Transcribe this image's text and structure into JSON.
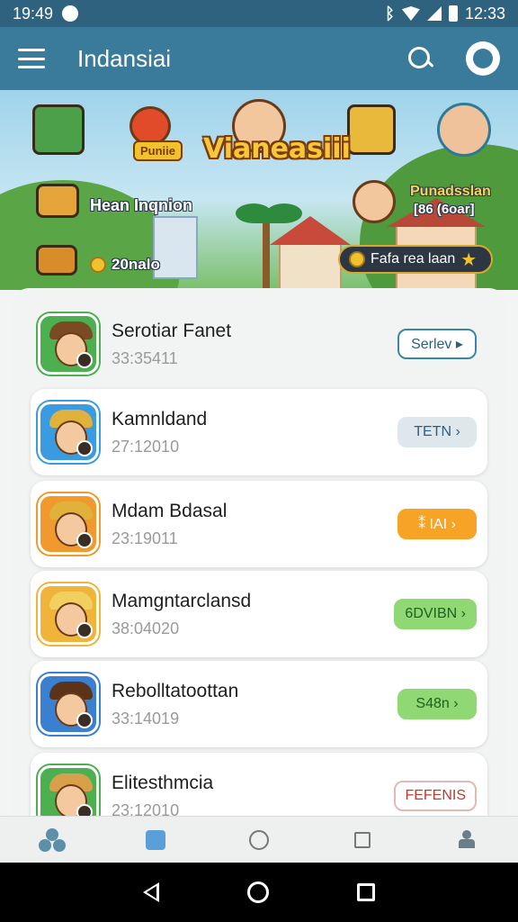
{
  "status_bar": {
    "time_left": "19:49",
    "time_right": "12:33"
  },
  "app_bar": {
    "title": "Indansiai"
  },
  "banner": {
    "title": "Vianeasiii",
    "label_left": "Hean Inqnion",
    "label_right_1": "Punadsslan",
    "label_right_2": "[86 (6oar]",
    "coin_text": "20nalo",
    "pill_text": "Fafa rea laan",
    "badge_text": "Puniie"
  },
  "list": [
    {
      "title": "Serotiar Fanet",
      "subtitle": "33:35411",
      "button": "Serlev ▸",
      "btn_bg": "#ffffff",
      "btn_fg": "#2f5f7e",
      "btn_border": "#3a86a8",
      "icon_bg": "#4caf50",
      "hat": "#7a4a22"
    },
    {
      "title": "Kamnldand",
      "subtitle": "27:12010",
      "button": "TETN ›",
      "btn_bg": "#dde7ec",
      "btn_fg": "#2f5f7e",
      "btn_border": "#dde7ec",
      "icon_bg": "#3b9be0",
      "hat": "#e0b23b"
    },
    {
      "title": "Mdam Bdasal",
      "subtitle": "23:19011",
      "button": "⁑ IAI ›",
      "btn_bg": "#f7a325",
      "btn_fg": "#ffffff",
      "btn_border": "#f7a325",
      "icon_bg": "#f09a2e",
      "hat": "#e0b23b"
    },
    {
      "title": "Mamgntarclansd",
      "subtitle": "38:04020",
      "button": "6DVIBN ›",
      "btn_bg": "#8fd873",
      "btn_fg": "#1f5f1f",
      "btn_border": "#8fd873",
      "icon_bg": "#f0b43a",
      "hat": "#f2d060"
    },
    {
      "title": "Rebolltatoottan",
      "subtitle": "33:14019",
      "button": "S48n ›",
      "btn_bg": "#8fd873",
      "btn_fg": "#1f5f1f",
      "btn_border": "#8fd873",
      "icon_bg": "#3b7fd0",
      "hat": "#5a3318"
    },
    {
      "title": "Elitesthmcia",
      "subtitle": "23:12010",
      "button": "FEFENIS",
      "btn_bg": "#ffffff",
      "btn_fg": "#c0392b",
      "btn_border": "#e5b8b3",
      "icon_bg": "#4caf50",
      "hat": "#d8a04a"
    }
  ]
}
